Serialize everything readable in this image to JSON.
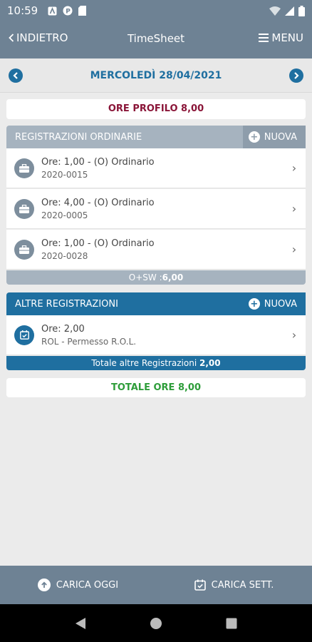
{
  "status_bar": {
    "time": "10:59"
  },
  "header": {
    "back_label": "INDIETRO",
    "title": "TimeSheet",
    "menu_label": "MENU"
  },
  "date_bar": {
    "date": "MERCOLEDÌ 28/04/2021"
  },
  "profile": {
    "label": "ORE PROFILO 8,00"
  },
  "ordinarie": {
    "title": "REGISTRAZIONI ORDINARIE",
    "new_label": "NUOVA",
    "items": [
      {
        "line1": "Ore: 1,00 - (O) Ordinario",
        "line2": "2020-0015"
      },
      {
        "line1": "Ore: 4,00 - (O) Ordinario",
        "line2": "2020-0005"
      },
      {
        "line1": "Ore: 1,00 - (O) Ordinario",
        "line2": "2020-0028"
      }
    ],
    "total_label": "O+SW :",
    "total_value": "6,00"
  },
  "altre": {
    "title": "ALTRE REGISTRAZIONI",
    "new_label": "NUOVA",
    "items": [
      {
        "line1": "Ore: 2,00",
        "line2": "ROL - Permesso R.O.L."
      }
    ],
    "total_label": "Totale altre Registrazioni",
    "total_value": "2,00"
  },
  "totale": {
    "label": "TOTALE ORE 8,00"
  },
  "bottom_bar": {
    "carica_oggi": "CARICA OGGI",
    "carica_sett": "CARICA SETT."
  },
  "colors": {
    "header": "#6e8294",
    "accent_blue": "#1f6fa0",
    "profile_red": "#8a1538",
    "total_green": "#2e9d3a",
    "section_grey": "#a6b3bf"
  }
}
